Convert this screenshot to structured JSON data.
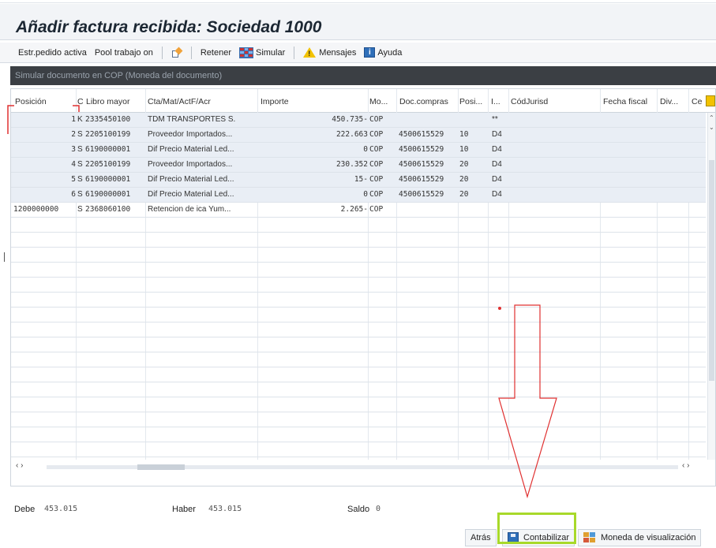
{
  "title": "Añadir factura recibida: Sociedad 1000",
  "toolbar": {
    "items": [
      {
        "label": "Estr.pedido activa"
      },
      {
        "label": "Pool trabajo on"
      },
      {
        "label": "Retener"
      },
      {
        "label": "Simular"
      },
      {
        "label": "Mensajes"
      },
      {
        "label": "Ayuda"
      }
    ]
  },
  "panel_header": "Simular documento en COP (Moneda del documento)",
  "columns": {
    "posicion": "Posición",
    "c": "C",
    "libro_mayor": "Libro mayor",
    "cta": "Cta/Mat/ActF/Acr",
    "importe": "Importe",
    "moneda": "Mo...",
    "doc_compras": "Doc.compras",
    "posi": "Posi...",
    "i": "I...",
    "cod_jurisd": "CódJurisd",
    "fecha_fiscal": "Fecha fiscal",
    "div": "Div...",
    "ce": "Ce"
  },
  "rows": [
    {
      "posicion": "",
      "num": "1",
      "c": "K",
      "libro": "2335450100",
      "cta": "TDM TRANSPORTES S.",
      "importe": "450.735-",
      "mon": "COP",
      "doc": "",
      "pos": "",
      "ind": "**"
    },
    {
      "posicion": "",
      "num": "2",
      "c": "S",
      "libro": "2205100199",
      "cta": "Proveedor Importados...",
      "importe": "222.663",
      "mon": "COP",
      "doc": "4500615529",
      "pos": "10",
      "ind": "D4"
    },
    {
      "posicion": "",
      "num": "3",
      "c": "S",
      "libro": "6190000001",
      "cta": "Dif Precio Material Led...",
      "importe": "0",
      "mon": "COP",
      "doc": "4500615529",
      "pos": "10",
      "ind": "D4"
    },
    {
      "posicion": "",
      "num": "4",
      "c": "S",
      "libro": "2205100199",
      "cta": "Proveedor Importados...",
      "importe": "230.352",
      "mon": "COP",
      "doc": "4500615529",
      "pos": "20",
      "ind": "D4"
    },
    {
      "posicion": "",
      "num": "5",
      "c": "S",
      "libro": "6190000001",
      "cta": "Dif Precio Material Led...",
      "importe": "15-",
      "mon": "COP",
      "doc": "4500615529",
      "pos": "20",
      "ind": "D4"
    },
    {
      "posicion": "",
      "num": "6",
      "c": "S",
      "libro": "6190000001",
      "cta": "Dif Precio Material Led...",
      "importe": "0",
      "mon": "COP",
      "doc": "4500615529",
      "pos": "20",
      "ind": "D4"
    },
    {
      "posicion": "1200000000",
      "num": "",
      "c": "S",
      "libro": "2368060100",
      "cta": "Retencion de ica Yum...",
      "importe": "2.265-",
      "mon": "COP",
      "doc": "",
      "pos": "",
      "ind": ""
    }
  ],
  "totals": {
    "debe_label": "Debe",
    "debe_value": "453.015",
    "haber_label": "Haber",
    "haber_value": "453.015",
    "saldo_label": "Saldo",
    "saldo_value": "0"
  },
  "bottom_buttons": {
    "atras": "Atrás",
    "contabilizar": "Contabilizar",
    "moneda": "Moneda de visualización"
  },
  "colors": {
    "panel_header_bg": "#3b3f44",
    "row_fill": "#e9eef5",
    "highlight": "#a8d92a",
    "annotation_red": "#e03030"
  },
  "icons": {
    "favorite": "favorite-icon",
    "simulate": "simulate-icon",
    "messages": "warning-icon",
    "help": "info-icon",
    "save": "save-icon",
    "currency": "currency-icon"
  }
}
